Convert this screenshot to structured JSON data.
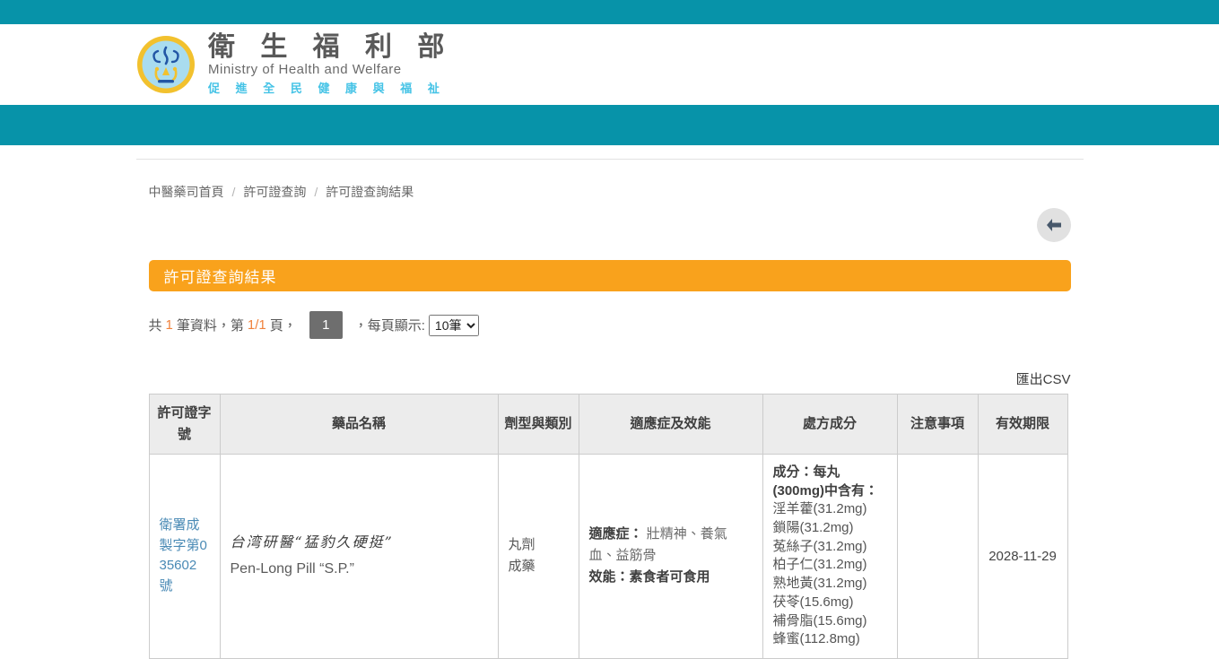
{
  "header": {
    "logo_icon": "mohw-seal-icon",
    "brand_zh": "衛 生 福 利 部",
    "brand_en": "Ministry of Health and Welfare",
    "tagline": "促 進 全 民 健 康 與 福 祉"
  },
  "breadcrumb": {
    "separator": "/",
    "items": [
      "中醫藥司首頁",
      "許可證查詢",
      "許可證查詢結果"
    ]
  },
  "banner": {
    "title": "許可證查詢結果"
  },
  "pagination": {
    "total_prefix": "共",
    "total_count": "1",
    "total_mid": "筆資料，第",
    "page_info": "1/1",
    "page_suffix": "頁，",
    "current_page": "1",
    "per_page_label": "，每頁顯示:",
    "per_page_value": "10筆"
  },
  "export_csv_label": "匯出CSV",
  "table": {
    "headers": [
      "許可證字號",
      "藥品名稱",
      "劑型與類別",
      "適應症及效能",
      "處方成分",
      "注意事項",
      "有效期限"
    ],
    "row": {
      "license_no": "衛署成製字第035602號",
      "name_zh": "台湾研醫“猛豹久硬挺”",
      "name_en": "Pen-Long Pill “S.P.”",
      "dosage_form": "丸劑",
      "category": "成藥",
      "indication_label": "適應症：",
      "indication_value": "壯精神、養氣血、益筋骨",
      "efficacy_line": "效能：素食者可食用",
      "ingredients_label": "成分：每丸(300mg)中含有：",
      "ingredients": [
        "淫羊藿(31.2mg)",
        "鎖陽(31.2mg)",
        "菟絲子(31.2mg)",
        "柏子仁(31.2mg)",
        "熟地黃(31.2mg)",
        "茯苓(15.6mg)",
        "補骨脂(15.6mg)",
        "蜂蜜(112.8mg)"
      ],
      "precautions": "",
      "expiry": "2028-11-29"
    }
  },
  "colors": {
    "teal": "#0793A9",
    "banner_orange": "#F9A21C",
    "accent_orange": "#F0823C",
    "link_blue": "#4a8ab5"
  }
}
